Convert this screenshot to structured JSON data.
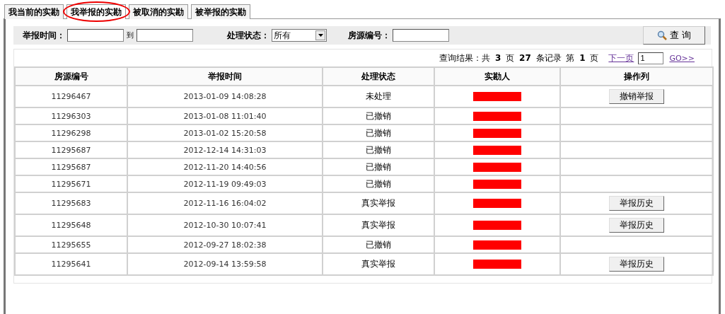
{
  "tabs": [
    {
      "label": "我当前的实勘",
      "selected": false,
      "circled": false
    },
    {
      "label": "我举报的实勘",
      "selected": true,
      "circled": true
    },
    {
      "label": "被取消的实勘",
      "selected": false,
      "circled": false
    },
    {
      "label": "被举报的实勘",
      "selected": false,
      "circled": false
    }
  ],
  "filters": {
    "report_time_label": "举报时间：",
    "range_separator": "到",
    "status_label": "处理状态：",
    "status_value": "所有",
    "house_id_label": "房源编号：",
    "search_button": "查 询"
  },
  "pagination": {
    "summary": "查询结果：共 **3** 页 **27** 条记录 第 **1** 页",
    "next_link": "下一页",
    "page_input": "1",
    "go_link": "GO>>"
  },
  "table": {
    "columns": [
      "房源编号",
      "举报时间",
      "处理状态",
      "实勘人",
      "操作列"
    ],
    "rows": [
      {
        "house_id": "11296467",
        "time": "2013-01-09 14:08:28",
        "status": "未处理",
        "action": "撤销举报"
      },
      {
        "house_id": "11296303",
        "time": "2013-01-08 11:01:40",
        "status": "已撤销"
      },
      {
        "house_id": "11296298",
        "time": "2013-01-02 15:20:58",
        "status": "已撤销"
      },
      {
        "house_id": "11295687",
        "time": "2012-12-14 14:31:03",
        "status": "已撤销"
      },
      {
        "house_id": "11295687",
        "time": "2012-11-20 14:40:56",
        "status": "已撤销"
      },
      {
        "house_id": "11295671",
        "time": "2012-11-19 09:49:03",
        "status": "已撤销"
      },
      {
        "house_id": "11295683",
        "time": "2012-11-16 16:04:02",
        "status": "真实举报",
        "action": "举报历史"
      },
      {
        "house_id": "11295648",
        "time": "2012-10-30 10:07:41",
        "status": "真实举报",
        "action": "举报历史"
      },
      {
        "house_id": "11295655",
        "time": "2012-09-27 18:02:38",
        "status": "已撤销"
      },
      {
        "house_id": "11295641",
        "time": "2012-09-14 13:59:58",
        "status": "真实举报",
        "action": "举报历史"
      }
    ]
  }
}
